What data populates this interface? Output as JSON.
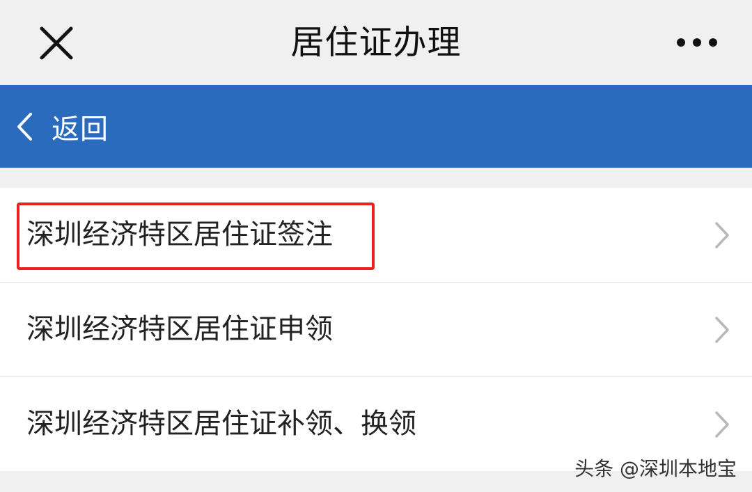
{
  "header": {
    "title": "居住证办理",
    "close_icon": "close-icon",
    "more_icon": "more-icon"
  },
  "navbar": {
    "back_label": "返回",
    "back_icon": "chevron-left-icon",
    "background_color": "#2b6bbd"
  },
  "list": {
    "items": [
      {
        "label": "深圳经济特区居住证签注",
        "highlighted": true
      },
      {
        "label": "深圳经济特区居住证申领",
        "highlighted": false
      },
      {
        "label": "深圳经济特区居住证补领、换领",
        "highlighted": false
      }
    ],
    "chevron_icon": "chevron-right-icon"
  },
  "annotation": {
    "highlight_color": "#e8231f"
  },
  "watermark": "头条 @深圳本地宝"
}
